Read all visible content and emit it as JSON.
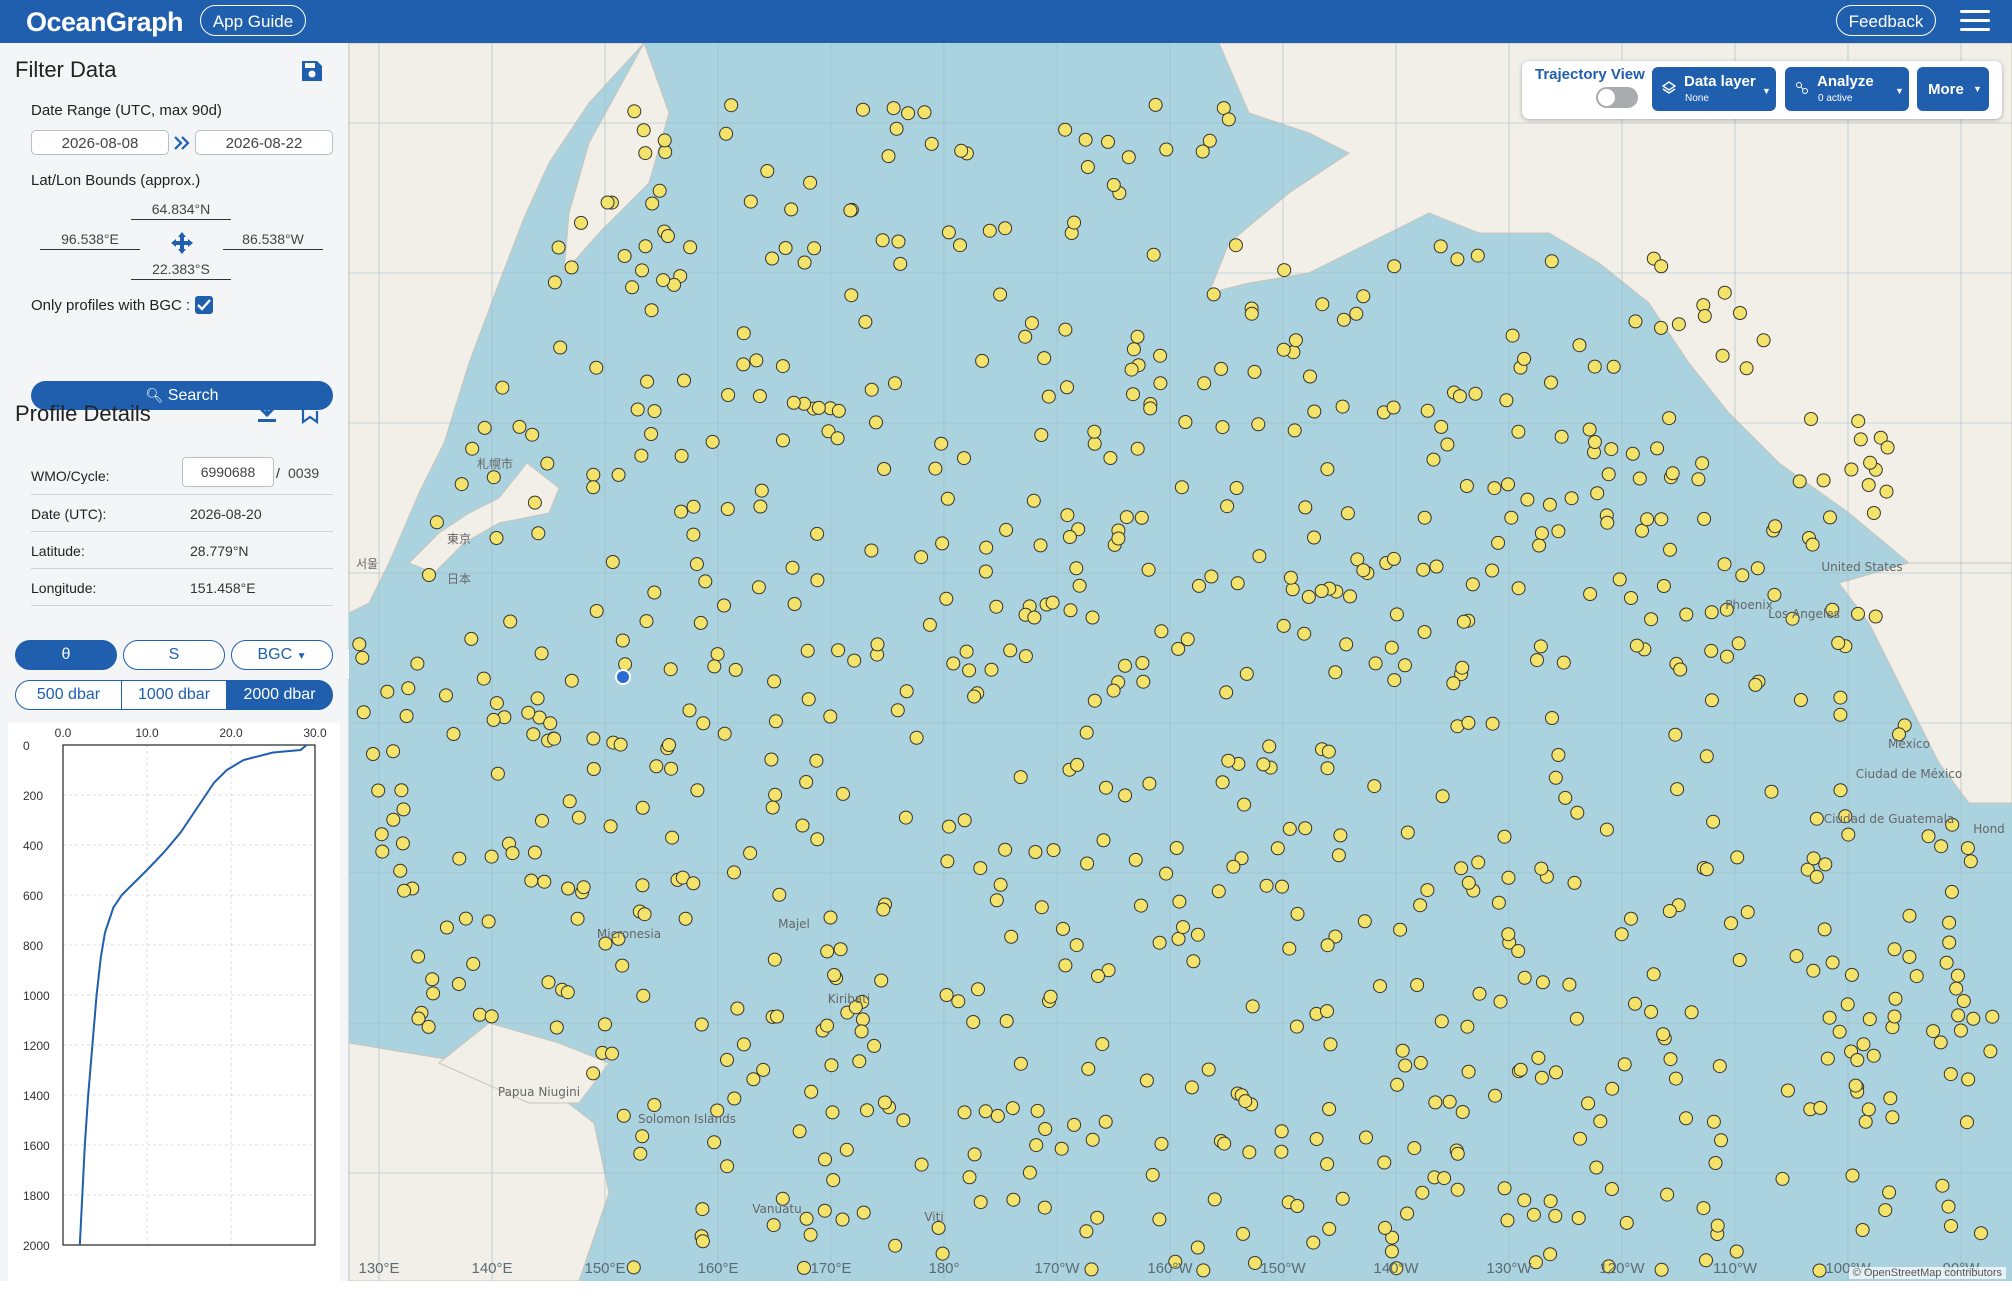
{
  "topbar": {
    "app_title": "OceanGraph",
    "app_guide_label": "App Guide",
    "feedback_label": "Feedback",
    "brand_color": "#1f5fae"
  },
  "filter": {
    "title": "Filter Data",
    "date_range_label": "Date Range (UTC, max 90d)",
    "date_start": "2026-08-08",
    "date_end": "2026-08-22",
    "bounds_label": "Lat/Lon Bounds (approx.)",
    "north": "64.834°N",
    "west": "96.538°E",
    "east": "86.538°W",
    "south": "22.383°S",
    "bgc_label": "Only profiles with BGC :",
    "bgc_checked": true,
    "search_label": "Search"
  },
  "details": {
    "title": "Profile Details",
    "wmo_label": "WMO/Cycle:",
    "wmo_value": "6990688",
    "cycle_separator": "/",
    "cycle_value": "0039",
    "date_label": "Date (UTC):",
    "date_value": "2026-08-20",
    "lat_label": "Latitude:",
    "lat_value": "28.779°N",
    "lon_label": "Longitude:",
    "lon_value": "151.458°E"
  },
  "variables": {
    "theta": "θ",
    "salinity": "S",
    "bgc": "BGC",
    "selected": "θ"
  },
  "depths": {
    "d500": "500 dbar",
    "d1000": "1000 dbar",
    "d2000": "2000 dbar",
    "selected": "2000 dbar"
  },
  "chart_data": {
    "type": "line",
    "title": "",
    "xlabel": "",
    "ylabel": "",
    "x_ticks": [
      "0.0",
      "10.0",
      "20.0",
      "30.0"
    ],
    "y_ticks": [
      "0",
      "200",
      "400",
      "600",
      "800",
      "1000",
      "1200",
      "1400",
      "1600",
      "1800",
      "2000"
    ],
    "xlim": [
      0,
      30
    ],
    "ylim": [
      2000,
      0
    ],
    "grid": true,
    "series": [
      {
        "color": "#1f5fae",
        "x": [
          29.0,
          28.3,
          25.0,
          21.5,
          19.5,
          18.0,
          16.0,
          14.0,
          12.0,
          10.0,
          8.5,
          7.0,
          6.0,
          5.0,
          4.5,
          4.0,
          3.5,
          3.0,
          2.6,
          2.3,
          2.0
        ],
        "y": [
          0,
          20,
          30,
          60,
          100,
          150,
          250,
          350,
          430,
          500,
          550,
          600,
          650,
          750,
          850,
          1000,
          1200,
          1400,
          1600,
          1800,
          2000
        ]
      }
    ]
  },
  "map": {
    "toolbar": {
      "trajectory_label": "Trajectory View",
      "trajectory_on": false,
      "data_layer_label": "Data layer",
      "data_layer_value": "None",
      "analyze_label": "Analyze",
      "analyze_value": "0 active",
      "more_label": "More"
    },
    "lon_labels": [
      "130°E",
      "140°E",
      "150°E",
      "160°E",
      "170°E",
      "180°",
      "170°W",
      "160°W",
      "150°W",
      "140°W",
      "130°W",
      "120°W",
      "110°W",
      "100°W",
      "90°W"
    ],
    "place_labels": [
      "札幌市",
      "東京",
      "日本",
      "서울",
      "Micronesia",
      "Majel",
      "Kiribati",
      "Papua Niugini",
      "Solomon Islands",
      "Vanuatu",
      "Viti",
      "United States",
      "Phoenix",
      "Los Angeles",
      "México",
      "Ciudad de México",
      "Ciudad de Guatemala",
      "Hond"
    ],
    "attribution": "© OpenStreetMap contributors",
    "ocean_color": "#aad3df",
    "land_color": "#f2efe9",
    "float_color": "#f3e36a",
    "selected_float_color": "#2a6bd3"
  }
}
